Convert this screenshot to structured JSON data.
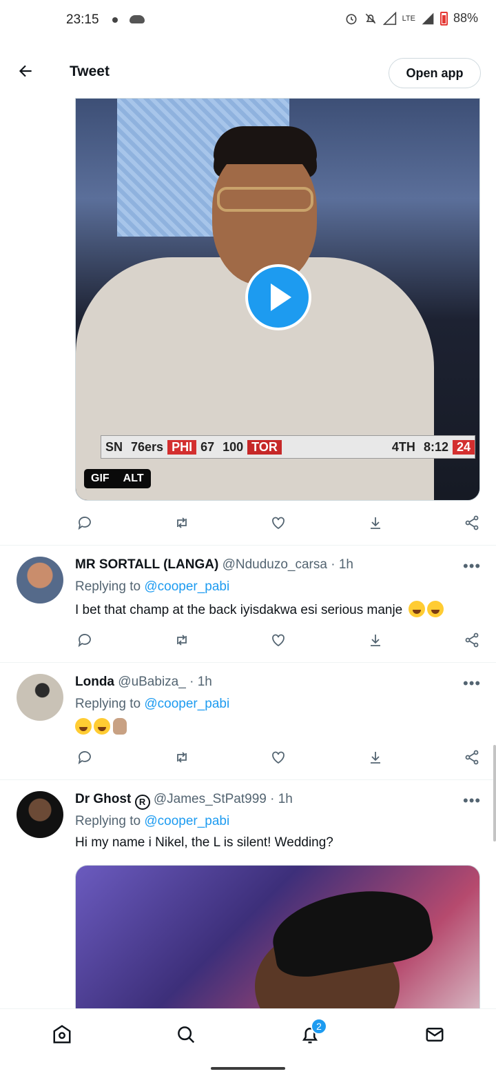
{
  "status": {
    "time": "23:15",
    "battery": "88%",
    "network": "LTE"
  },
  "topbar": {
    "title": "Tweet",
    "open_app": "Open app"
  },
  "media1": {
    "badge_gif": "GIF",
    "badge_alt": "ALT",
    "scoreboard": [
      "SN",
      "76ers",
      "PHI",
      "67",
      "100",
      "TOR",
      "4TH",
      "8:12",
      "24"
    ]
  },
  "replies": [
    {
      "name": "MR SORTALL (LANGA)",
      "handle": "@Nduduzo_carsa",
      "time": "· 1h",
      "replying_prefix": "Replying to",
      "replying_handle": "@cooper_pabi",
      "text": "I bet that champ at the back iyisdakwa esi serious manje"
    },
    {
      "name": "Londa",
      "handle": "@uBabiza_",
      "time": "· 1h",
      "replying_prefix": "Replying to",
      "replying_handle": "@cooper_pabi",
      "text": ""
    },
    {
      "name": "Dr Ghost",
      "badge": "R",
      "handle": "@James_StPat999",
      "time": "· 1h",
      "replying_prefix": "Replying to",
      "replying_handle": "@cooper_pabi",
      "text": "Hi my name i Nikel, the L is silent! Wedding?"
    }
  ],
  "more_label": "•••",
  "nav": {
    "notifications_count": "2"
  },
  "icons": {
    "back": "arrow-left-icon",
    "reply": "comment-icon",
    "retweet": "retweet-icon",
    "like": "heart-icon",
    "bookmark": "download-icon",
    "share": "share-icon",
    "home": "home-icon",
    "search": "search-icon",
    "notifications": "bell-icon",
    "messages": "mail-icon"
  },
  "colors": {
    "accent": "#1d9bf0",
    "text": "#0f1419",
    "muted": "#536471"
  }
}
